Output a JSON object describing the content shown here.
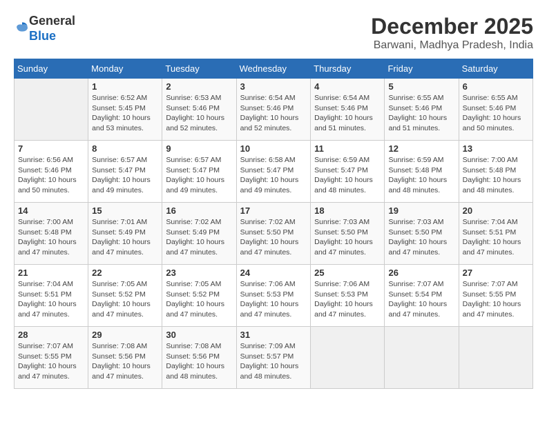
{
  "logo": {
    "general": "General",
    "blue": "Blue"
  },
  "title": "December 2025",
  "subtitle": "Barwani, Madhya Pradesh, India",
  "days_of_week": [
    "Sunday",
    "Monday",
    "Tuesday",
    "Wednesday",
    "Thursday",
    "Friday",
    "Saturday"
  ],
  "weeks": [
    [
      {
        "day": "",
        "content": ""
      },
      {
        "day": "1",
        "content": "Sunrise: 6:52 AM\nSunset: 5:45 PM\nDaylight: 10 hours\nand 53 minutes."
      },
      {
        "day": "2",
        "content": "Sunrise: 6:53 AM\nSunset: 5:46 PM\nDaylight: 10 hours\nand 52 minutes."
      },
      {
        "day": "3",
        "content": "Sunrise: 6:54 AM\nSunset: 5:46 PM\nDaylight: 10 hours\nand 52 minutes."
      },
      {
        "day": "4",
        "content": "Sunrise: 6:54 AM\nSunset: 5:46 PM\nDaylight: 10 hours\nand 51 minutes."
      },
      {
        "day": "5",
        "content": "Sunrise: 6:55 AM\nSunset: 5:46 PM\nDaylight: 10 hours\nand 51 minutes."
      },
      {
        "day": "6",
        "content": "Sunrise: 6:55 AM\nSunset: 5:46 PM\nDaylight: 10 hours\nand 50 minutes."
      }
    ],
    [
      {
        "day": "7",
        "content": "Sunrise: 6:56 AM\nSunset: 5:46 PM\nDaylight: 10 hours\nand 50 minutes."
      },
      {
        "day": "8",
        "content": "Sunrise: 6:57 AM\nSunset: 5:47 PM\nDaylight: 10 hours\nand 49 minutes."
      },
      {
        "day": "9",
        "content": "Sunrise: 6:57 AM\nSunset: 5:47 PM\nDaylight: 10 hours\nand 49 minutes."
      },
      {
        "day": "10",
        "content": "Sunrise: 6:58 AM\nSunset: 5:47 PM\nDaylight: 10 hours\nand 49 minutes."
      },
      {
        "day": "11",
        "content": "Sunrise: 6:59 AM\nSunset: 5:47 PM\nDaylight: 10 hours\nand 48 minutes."
      },
      {
        "day": "12",
        "content": "Sunrise: 6:59 AM\nSunset: 5:48 PM\nDaylight: 10 hours\nand 48 minutes."
      },
      {
        "day": "13",
        "content": "Sunrise: 7:00 AM\nSunset: 5:48 PM\nDaylight: 10 hours\nand 48 minutes."
      }
    ],
    [
      {
        "day": "14",
        "content": "Sunrise: 7:00 AM\nSunset: 5:48 PM\nDaylight: 10 hours\nand 47 minutes."
      },
      {
        "day": "15",
        "content": "Sunrise: 7:01 AM\nSunset: 5:49 PM\nDaylight: 10 hours\nand 47 minutes."
      },
      {
        "day": "16",
        "content": "Sunrise: 7:02 AM\nSunset: 5:49 PM\nDaylight: 10 hours\nand 47 minutes."
      },
      {
        "day": "17",
        "content": "Sunrise: 7:02 AM\nSunset: 5:50 PM\nDaylight: 10 hours\nand 47 minutes."
      },
      {
        "day": "18",
        "content": "Sunrise: 7:03 AM\nSunset: 5:50 PM\nDaylight: 10 hours\nand 47 minutes."
      },
      {
        "day": "19",
        "content": "Sunrise: 7:03 AM\nSunset: 5:50 PM\nDaylight: 10 hours\nand 47 minutes."
      },
      {
        "day": "20",
        "content": "Sunrise: 7:04 AM\nSunset: 5:51 PM\nDaylight: 10 hours\nand 47 minutes."
      }
    ],
    [
      {
        "day": "21",
        "content": "Sunrise: 7:04 AM\nSunset: 5:51 PM\nDaylight: 10 hours\nand 47 minutes."
      },
      {
        "day": "22",
        "content": "Sunrise: 7:05 AM\nSunset: 5:52 PM\nDaylight: 10 hours\nand 47 minutes."
      },
      {
        "day": "23",
        "content": "Sunrise: 7:05 AM\nSunset: 5:52 PM\nDaylight: 10 hours\nand 47 minutes."
      },
      {
        "day": "24",
        "content": "Sunrise: 7:06 AM\nSunset: 5:53 PM\nDaylight: 10 hours\nand 47 minutes."
      },
      {
        "day": "25",
        "content": "Sunrise: 7:06 AM\nSunset: 5:53 PM\nDaylight: 10 hours\nand 47 minutes."
      },
      {
        "day": "26",
        "content": "Sunrise: 7:07 AM\nSunset: 5:54 PM\nDaylight: 10 hours\nand 47 minutes."
      },
      {
        "day": "27",
        "content": "Sunrise: 7:07 AM\nSunset: 5:55 PM\nDaylight: 10 hours\nand 47 minutes."
      }
    ],
    [
      {
        "day": "28",
        "content": "Sunrise: 7:07 AM\nSunset: 5:55 PM\nDaylight: 10 hours\nand 47 minutes."
      },
      {
        "day": "29",
        "content": "Sunrise: 7:08 AM\nSunset: 5:56 PM\nDaylight: 10 hours\nand 47 minutes."
      },
      {
        "day": "30",
        "content": "Sunrise: 7:08 AM\nSunset: 5:56 PM\nDaylight: 10 hours\nand 48 minutes."
      },
      {
        "day": "31",
        "content": "Sunrise: 7:09 AM\nSunset: 5:57 PM\nDaylight: 10 hours\nand 48 minutes."
      },
      {
        "day": "",
        "content": ""
      },
      {
        "day": "",
        "content": ""
      },
      {
        "day": "",
        "content": ""
      }
    ]
  ]
}
